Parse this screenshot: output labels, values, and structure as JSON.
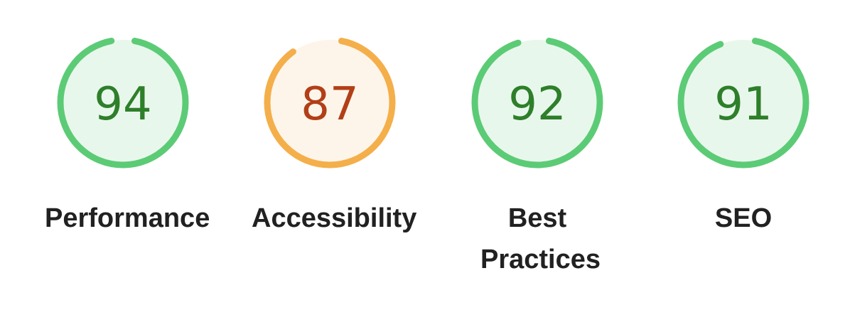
{
  "colors": {
    "pass_ring": "#5CCB76",
    "pass_fill": "#E8F7EC",
    "pass_text": "#2E7F2A",
    "average_ring": "#F4AF4A",
    "average_fill": "#FEF5EA",
    "average_text": "#B23F17",
    "track": "#E8F7EC"
  },
  "categories": [
    {
      "id": "performance",
      "score": "94",
      "label": "Performance",
      "status": "pass"
    },
    {
      "id": "accessibility",
      "score": "87",
      "label": "Accessibility",
      "status": "average"
    },
    {
      "id": "best-practices",
      "score": "92",
      "label": "Best Practices",
      "status": "pass"
    },
    {
      "id": "seo",
      "score": "91",
      "label": "SEO",
      "status": "pass"
    }
  ]
}
